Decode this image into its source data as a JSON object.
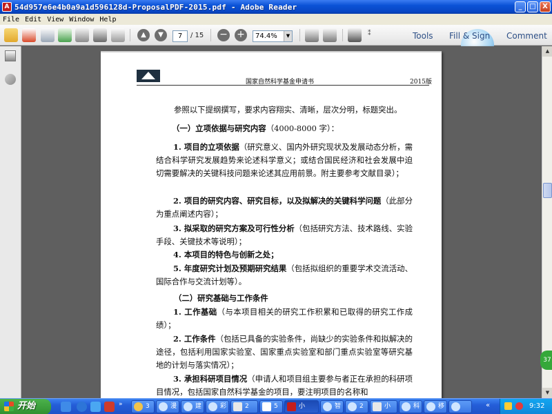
{
  "window": {
    "title": "54d957e6e4b0a9a1d596128d-ProposalPDF-2015.pdf - Adobe Reader",
    "buttons": {
      "minimize": "_",
      "maximize": "□",
      "close": "X"
    }
  },
  "menu": [
    "File",
    "Edit",
    "View",
    "Window",
    "Help"
  ],
  "toolbar": {
    "page_current": "7",
    "page_total": "/ 15",
    "zoom": "74.4%",
    "zoom_out": "−",
    "zoom_in": "+",
    "links": {
      "tools": "Tools",
      "fill_sign": "Fill & Sign",
      "comment": "Comment"
    }
  },
  "document": {
    "header_center": "国家自然科学基金申请书",
    "header_right": "2015版",
    "intro": "参照以下提纲撰写，要求内容翔实、清晰，层次分明，标题突出。",
    "section1_title": "（一）立项依据与研究内容",
    "section1_note": "（4000-8000 字）：",
    "item1_title": "1.  项目的立项依据",
    "item1_text": "（研究意义、国内外研究现状及发展动态分析，需结合科学研究发展趋势来论述科学意义；或结合国民经济和社会发展中迫切需要解决的关键科技问题来论述其应用前景。附主要参考文献目录）；",
    "item2_title": "2.  项目的研究内容、研究目标，以及拟解决的关键科学问题",
    "item2_text": "（此部分为重点阐述内容）；",
    "item3_title": "3.  拟采取的研究方案及可行性分析",
    "item3_text": "（包括研究方法、技术路线、实验手段、关键技术等说明）；",
    "item4_title": "4.  本项目的特色与创新之处；",
    "item5_title": "5.  年度研究计划及预期研究结果",
    "item5_text": "（包括拟组织的重要学术交流活动、国际合作与交流计划等）。",
    "section2_title": "（二）研究基础与工作条件",
    "s2_item1_title": "1.  工作基础",
    "s2_item1_text": "（与本项目相关的研究工作积累和已取得的研究工作成绩）；",
    "s2_item2_title": "2.  工作条件",
    "s2_item2_text": "（包括已具备的实验条件，尚缺少的实验条件和拟解决的途径，包括利用国家实验室、国家重点实验室和部门重点实验室等研究基地的计划与落实情况）；",
    "s2_item3_title": "3.  承担科研项目情况",
    "s2_item3_text": "（申请人和项目组主要参与者正在承担的科研项目情况，包括国家自然科学基金的项目，要注明项目的名称和"
  },
  "scrollbar": {
    "badge": "37"
  },
  "taskbar": {
    "start": "开始",
    "tasks": [
      "3",
      "漫",
      "建",
      "彩",
      "2",
      "5",
      "小",
      "智",
      "2",
      "小",
      "科",
      "移"
    ],
    "clock": "9:32"
  }
}
